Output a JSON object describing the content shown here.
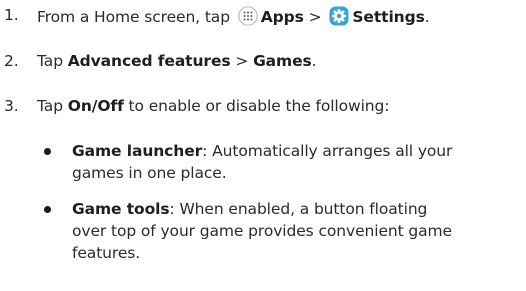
{
  "steps": [
    {
      "number": "1.",
      "prefix": "From a Home screen, tap ",
      "apps_icon": "apps-grid-icon",
      "apps_label": "Apps",
      "sep": " > ",
      "settings_icon": "settings-gear-icon",
      "settings_label": "Settings",
      "suffix": "."
    },
    {
      "number": "2.",
      "prefix": "Tap ",
      "bold1": "Advanced features",
      "sep": " > ",
      "bold2": "Games",
      "suffix": "."
    },
    {
      "number": "3.",
      "prefix": "Tap ",
      "bold": "On/Off",
      "suffix": " to enable or disable the following:"
    }
  ],
  "bullets": [
    {
      "term": "Game launcher",
      "line1": ": Automatically arranges all your",
      "line2": "games in one place."
    },
    {
      "term": "Game tools",
      "line1": ": When enabled, a button floating",
      "line2": "over top of your game provides convenient game",
      "line3": "features."
    }
  ],
  "colors": {
    "text": "#2b2b2b",
    "settings_icon_bg": "#3aa3d8",
    "apps_icon_bg": "#ffffff"
  }
}
